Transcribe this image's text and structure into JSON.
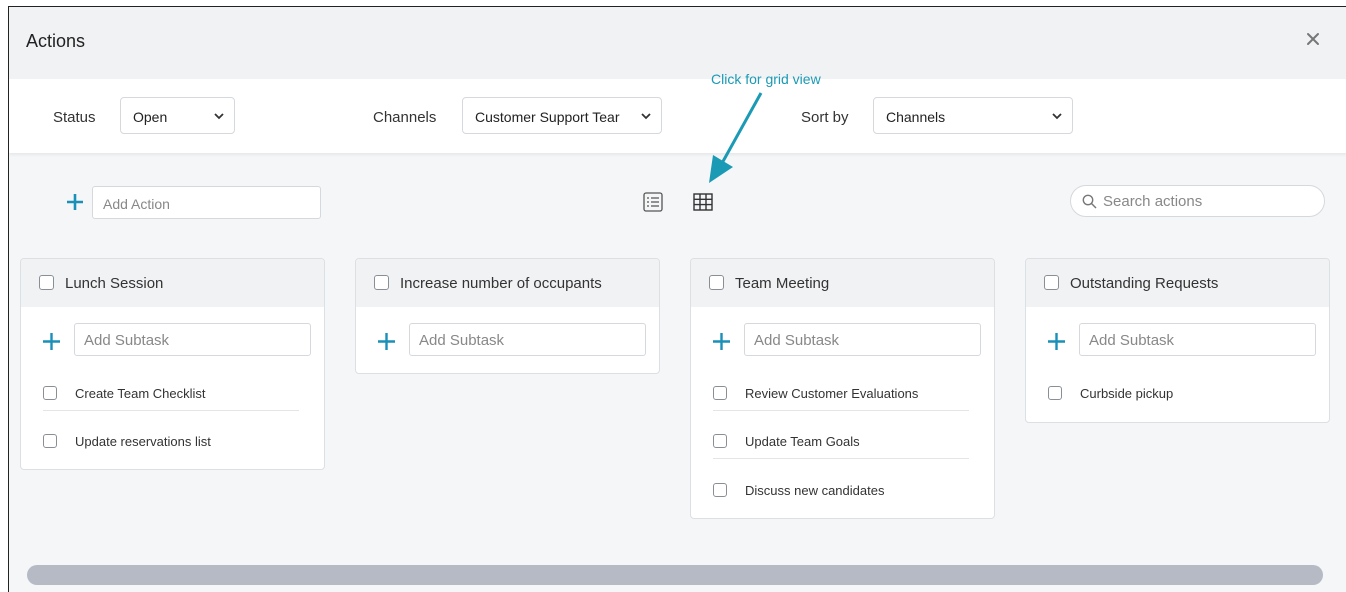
{
  "dialog": {
    "title": "Actions"
  },
  "filters": {
    "status": {
      "label": "Status",
      "value": "Open"
    },
    "channels": {
      "label": "Channels",
      "value": "Customer Support Tear"
    },
    "sort": {
      "label": "Sort by",
      "value": "Channels"
    }
  },
  "annotation": {
    "text": "Click for grid view",
    "color": "#1a9ab5"
  },
  "toolbar": {
    "add_action_placeholder": "Add Action",
    "search_placeholder": "Search actions",
    "views": [
      "list-view-icon",
      "grid-view-icon"
    ]
  },
  "cards": [
    {
      "title": "Lunch Session",
      "subtask_placeholder": "Add Subtask",
      "tasks": [
        "Create Team Checklist",
        "Update reservations list"
      ]
    },
    {
      "title": "Increase number of occupants",
      "subtask_placeholder": "Add Subtask",
      "tasks": []
    },
    {
      "title": "Team Meeting",
      "subtask_placeholder": "Add Subtask",
      "tasks": [
        "Review Customer Evaluations",
        "Update Team Goals",
        "Discuss new candidates"
      ]
    },
    {
      "title": "Outstanding Requests",
      "subtask_placeholder": "Add Subtask",
      "tasks": [
        "Curbside pickup"
      ]
    }
  ],
  "colors": {
    "accent": "#1a9ab5",
    "header_bg": "#f1f2f4",
    "scrollbar": "#b6bac5"
  }
}
